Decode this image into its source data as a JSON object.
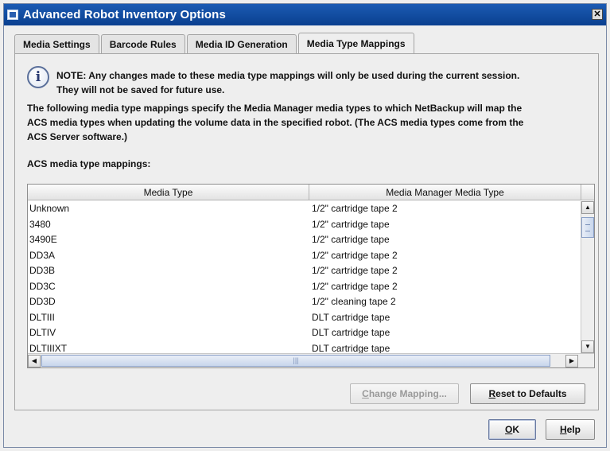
{
  "window": {
    "title": "Advanced Robot Inventory Options",
    "close_glyph": "✕"
  },
  "tabs": [
    {
      "label": "Media Settings",
      "active": false
    },
    {
      "label": "Barcode Rules",
      "active": false
    },
    {
      "label": "Media ID Generation",
      "active": false
    },
    {
      "label": "Media Type Mappings",
      "active": true
    }
  ],
  "note": {
    "icon": "info-icon",
    "glyph": "i",
    "line1": "NOTE: Any changes made to these media type mappings will only be used during the current session.",
    "line2": "They will not be saved for future use."
  },
  "description": {
    "line1": "The following media type mappings specify the Media Manager media types to which NetBackup will map the",
    "line2": "ACS media types when updating the volume data in the specified robot.  (The ACS media types come from the",
    "line3": "ACS Server software.)"
  },
  "mappings_label": "ACS media type mappings:",
  "table": {
    "columns": [
      "Media Type",
      "Media Manager Media Type"
    ],
    "rows": [
      [
        "Unknown",
        "1/2\" cartridge tape 2"
      ],
      [
        "3480",
        "1/2\" cartridge tape"
      ],
      [
        "3490E",
        "1/2\" cartridge tape"
      ],
      [
        "DD3A",
        "1/2\" cartridge tape 2"
      ],
      [
        "DD3B",
        "1/2\" cartridge tape 2"
      ],
      [
        "DD3C",
        "1/2\" cartridge tape 2"
      ],
      [
        "DD3D",
        "1/2\" cleaning tape 2"
      ],
      [
        "DLTIII",
        "DLT cartridge tape"
      ],
      [
        "DLTIV",
        "DLT cartridge tape"
      ],
      [
        "DLTIIIXT",
        "DLT cartridge tape"
      ]
    ],
    "scroll_up_glyph": "▲",
    "scroll_down_glyph": "▼",
    "scroll_left_glyph": "◀",
    "scroll_right_glyph": "▶",
    "hthumb_grip": "|||"
  },
  "buttons": {
    "change_mapping_pre": "",
    "change_mapping_mnemonic": "C",
    "change_mapping_post": "hange Mapping...",
    "reset_pre": "",
    "reset_mnemonic": "R",
    "reset_post": "eset to Defaults",
    "ok_pre": "",
    "ok_mnemonic": "O",
    "ok_post": "K",
    "help_pre": "",
    "help_mnemonic": "H",
    "help_post": "elp"
  }
}
